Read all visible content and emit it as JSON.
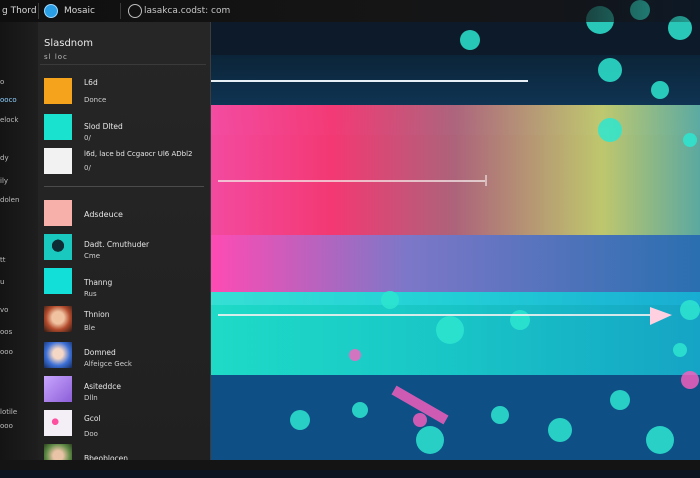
{
  "topbar": {
    "app_title": "g Thord",
    "tab_label": "Mosaic",
    "address": "lasakca.codst: com"
  },
  "nav": {
    "items": [
      {
        "label": "o"
      },
      {
        "label": "ooco",
        "active": true
      },
      {
        "label": "elock"
      },
      {
        "label": "dy"
      },
      {
        "label": "ily"
      },
      {
        "label": "dolen"
      },
      {
        "label": "tt"
      },
      {
        "label": "u"
      },
      {
        "label": "vo"
      },
      {
        "label": "oos"
      },
      {
        "label": "ooo"
      },
      {
        "label": "lotile"
      },
      {
        "label": "ooo"
      }
    ]
  },
  "panel": {
    "title": "Slasdnom",
    "subtitle": "sl   loc",
    "rows": [
      {
        "line1": "L6d",
        "line2": "Donce",
        "color": "#f5a31d"
      },
      {
        "line1": "Slod Dlted",
        "line2": "0/",
        "color": "#19e3cf"
      },
      {
        "line1": "l6d, lace bd Ccgaocr Ul6 ADbl2",
        "line2": "0/",
        "color": "#f2f2f2"
      },
      {
        "line1": "Adsdeuce",
        "line2": "",
        "color": "#f7a8a8"
      },
      {
        "line1": "Dadt. Cmuthuder",
        "line2": "Cme",
        "color": "#19c9c0"
      },
      {
        "line1": "Thanng",
        "line2": "Rus",
        "color": "#12e0d8"
      },
      {
        "line1": "Thnion",
        "line2": "Ble",
        "color": "#d96a3a"
      },
      {
        "line1": "Domned",
        "line2": "Alfeigce Geck",
        "color": "#3b6fd6"
      },
      {
        "line1": "Asiteddce",
        "line2": "Dlln",
        "color": "#b58cff"
      },
      {
        "line1": "Gcol",
        "line2": "Doo",
        "color": "#f4eef6"
      },
      {
        "line1": "Bbeoblocen",
        "line2": "",
        "color": "#5d8a45"
      }
    ]
  }
}
